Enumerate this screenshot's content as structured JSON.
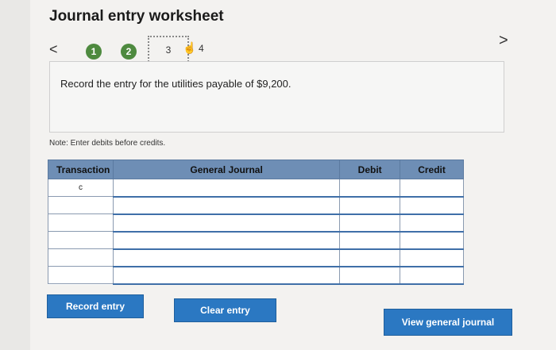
{
  "title": "Journal entry worksheet",
  "nav": {
    "prev": "<",
    "next": ">"
  },
  "steps": [
    "1",
    "2",
    "3",
    "4"
  ],
  "prompt": "Record the entry for the utilities payable of $9,200.",
  "note": "Note: Enter debits before credits.",
  "table": {
    "headers": [
      "Transaction",
      "General Journal",
      "Debit",
      "Credit"
    ],
    "rows": [
      [
        "c",
        "",
        "",
        ""
      ],
      [
        "",
        "",
        "",
        ""
      ],
      [
        "",
        "",
        "",
        ""
      ],
      [
        "",
        "",
        "",
        ""
      ],
      [
        "",
        "",
        "",
        ""
      ],
      [
        "",
        "",
        "",
        ""
      ]
    ]
  },
  "buttons": {
    "record": "Record entry",
    "clear": "Clear entry",
    "view": "View general journal"
  }
}
